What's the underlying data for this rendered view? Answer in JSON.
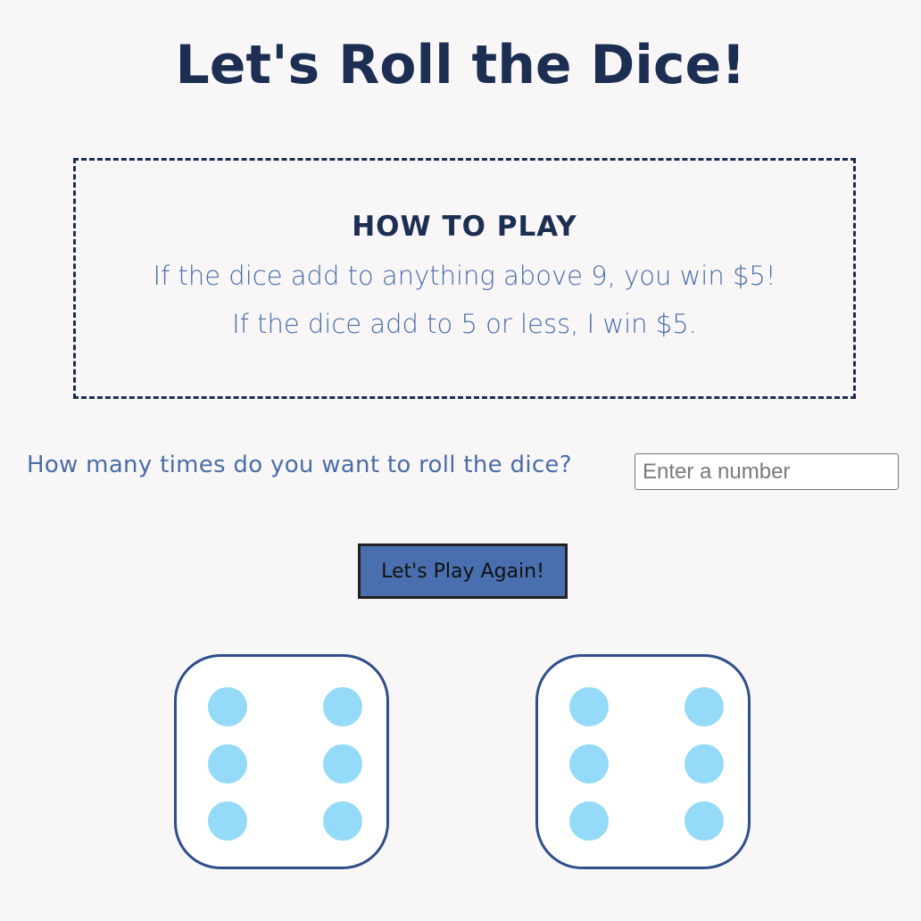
{
  "page": {
    "title": "Let's Roll the Dice!"
  },
  "rules": {
    "heading": "HOW TO PLAY",
    "line1": "If the dice add to anything above 9, you win $5!",
    "line2": "If the dice add to 5 or less, I win $5."
  },
  "roll_form": {
    "label": "How many times do you want to roll the dice?",
    "placeholder": "Enter a number",
    "value": "",
    "button_label": "Let's Play Again!"
  },
  "dice": [
    {
      "name": "die-1",
      "value": 6
    },
    {
      "name": "die-2",
      "value": 6
    }
  ],
  "colors": {
    "heading": "#1c2e52",
    "accent_text": "#4a6da8",
    "button_bg": "#4a6fae",
    "die_border": "#2f4f8a",
    "pip": "#95daf8",
    "page_bg": "#f8f6f7"
  }
}
